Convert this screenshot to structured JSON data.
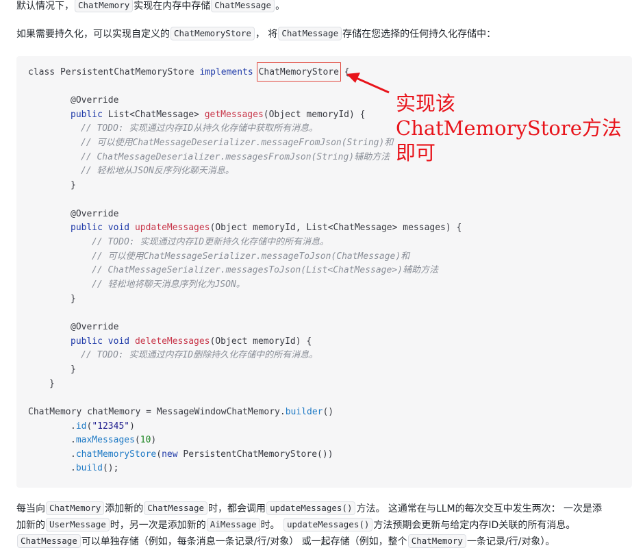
{
  "p1": {
    "t1": "默认情况下，",
    "c1": "ChatMemory",
    "t2": "实现在内存中存储",
    "c2": "ChatMessage",
    "t3": "。"
  },
  "p2": {
    "t1": "如果需要持久化，可以实现自定义的",
    "c1": "ChatMemoryStore",
    "t2": "， 将",
    "c2": "ChatMessage",
    "t3": "存储在您选择的任何持久化存储中："
  },
  "code": {
    "l1": {
      "a": "class PersistentChatMemoryStore ",
      "kw": "implements",
      "box": "ChatMemoryStore",
      "z": " {"
    },
    "l2": "@Override",
    "l3": {
      "kw": "public",
      "a": " List<ChatMessage> ",
      "fn": "getMessages",
      "z": "(Object memoryId) {"
    },
    "l4": "// TODO: 实现通过内存ID从持久化存储中获取所有消息。",
    "l5": "// 可以使用ChatMessageDeserializer.messageFromJson(String)和",
    "l6": "// ChatMessageDeserializer.messagesFromJson(String)辅助方法",
    "l7": "// 轻松地从JSON反序列化聊天消息。",
    "l8": "}",
    "l9": "@Override",
    "l10": {
      "kw1": "public",
      "kw2": "void",
      "fn": "updateMessages",
      "z": "(Object memoryId, List<ChatMessage> messages) {"
    },
    "l11": "// TODO: 实现通过内存ID更新持久化存储中的所有消息。",
    "l12": "// 可以使用ChatMessageSerializer.messageToJson(ChatMessage)和",
    "l13": "// ChatMessageSerializer.messagesToJson(List<ChatMessage>)辅助方法",
    "l14": "// 轻松地将聊天消息序列化为JSON。",
    "l15": "}",
    "l16": "@Override",
    "l17": {
      "kw1": "public",
      "kw2": "void",
      "fn": "deleteMessages",
      "z": "(Object memoryId) {"
    },
    "l18": "// TODO: 实现通过内存ID删除持久化存储中的所有消息。",
    "l19": "}",
    "l20": "}",
    "l21": {
      "a": "ChatMemory chatMemory = MessageWindowChatMemory.",
      "m": "builder",
      "z": "()"
    },
    "l22": {
      "d": ".",
      "m": "id",
      "o": "(",
      "s": "\"12345\"",
      "z": ")"
    },
    "l23": {
      "d": ".",
      "m": "maxMessages",
      "o": "(",
      "n": "10",
      "z": ")"
    },
    "l24": {
      "d": ".",
      "m": "chatMemoryStore",
      "o": "(",
      "kw": "new",
      "z": " PersistentChatMemoryStore())"
    },
    "l25": {
      "d": ".",
      "m": "build",
      "z": "();"
    }
  },
  "annotation": {
    "line1": "实现该",
    "line2": "ChatMemoryStore方法",
    "line3": "即可",
    "color": "#e8141b"
  },
  "p3": {
    "t1": "每当向",
    "c1": "ChatMemory",
    "t2": "添加新的",
    "c2": "ChatMessage",
    "t3": "时，都会调用",
    "c3": "updateMessages()",
    "t4": "方法。 这通常在与LLM的每次交互中发生两次： 一次是添"
  },
  "p4": {
    "t1": "加新的",
    "c1": "UserMessage",
    "t2": "时，另一次是添加新的",
    "c2": "AiMessage",
    "t3": "时。 ",
    "c3": "updateMessages()",
    "t4": "方法预期会更新与给定内存ID关联的所有消息。"
  },
  "p5": {
    "c1": "ChatMessage",
    "t1": "可以单独存储（例如，每条消息一条记录/行/对象） 或一起存储（例如，整个",
    "c2": "ChatMemory",
    "t2": "一条记录/行/对象）。"
  }
}
